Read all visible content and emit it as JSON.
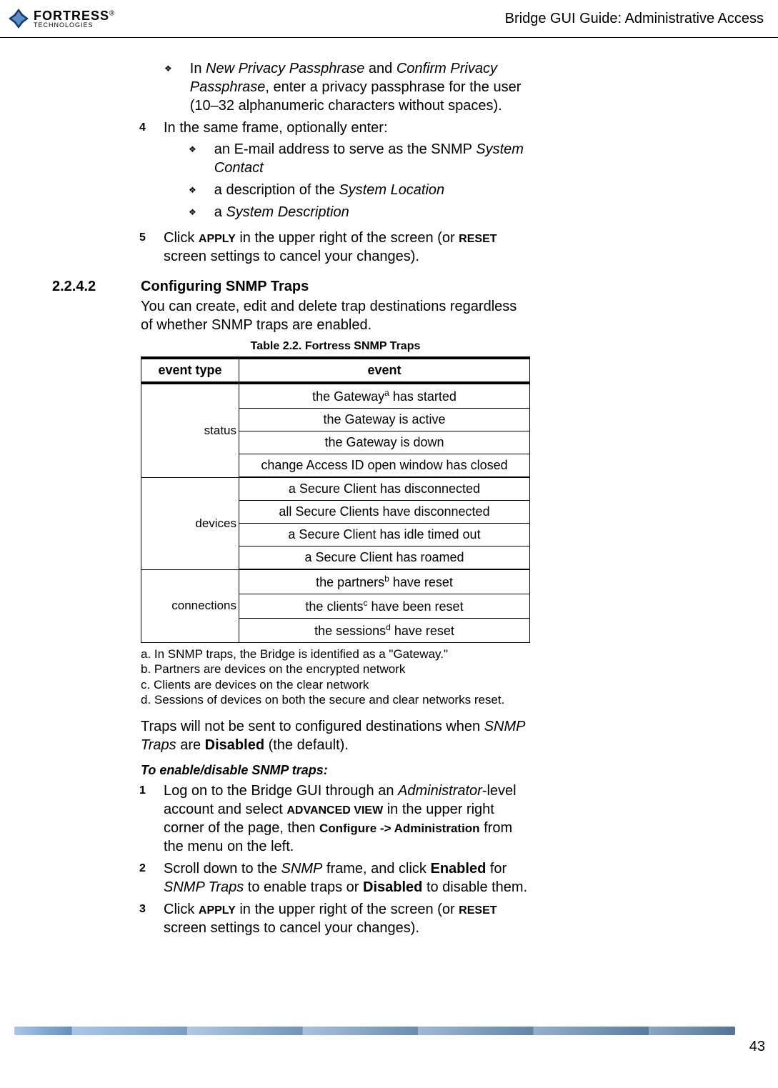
{
  "header": {
    "logo_text": "FORTRESS",
    "logo_sub": "TECHNOLOGIES",
    "title": "Bridge GUI Guide: Administrative Access"
  },
  "intro_bullet": {
    "text_prefix": "In ",
    "em1": "New Privacy Passphrase",
    "mid": " and ",
    "em2": "Confirm Privacy Passphrase",
    "text_suffix": ", enter a privacy passphrase for the user (10–32 alphanumeric characters without spaces)."
  },
  "step4": {
    "num": "4",
    "text": "In the same frame, optionally enter:",
    "bullets": [
      {
        "prefix": "an E-mail address to serve as the SNMP ",
        "em": "System Contact",
        "suffix": ""
      },
      {
        "prefix": "a description of the ",
        "em": "System Location",
        "suffix": ""
      },
      {
        "prefix": "a ",
        "em": "System Description",
        "suffix": ""
      }
    ]
  },
  "step5": {
    "num": "5",
    "pre": "Click ",
    "apply": "APPLY",
    "mid": " in the upper right of the screen (or ",
    "reset": "RESET",
    "post": " screen settings to cancel your changes)."
  },
  "section": {
    "num": "2.2.4.2",
    "title": "Configuring SNMP Traps",
    "intro": "You can create, edit and delete trap destinations regardless of whether SNMP traps are enabled."
  },
  "table": {
    "caption": "Table 2.2. Fortress SNMP Traps",
    "header_type": "event type",
    "header_event": "event",
    "groups": [
      {
        "type": "status",
        "events": [
          {
            "pre": "the Gateway",
            "sup": "a",
            "post": " has started"
          },
          {
            "pre": "the Gateway is active",
            "sup": "",
            "post": ""
          },
          {
            "pre": "the Gateway is down",
            "sup": "",
            "post": ""
          },
          {
            "pre": "change Access ID open window has closed",
            "sup": "",
            "post": ""
          }
        ]
      },
      {
        "type": "devices",
        "events": [
          {
            "pre": "a Secure Client has disconnected",
            "sup": "",
            "post": ""
          },
          {
            "pre": "all Secure Clients have disconnected",
            "sup": "",
            "post": ""
          },
          {
            "pre": "a Secure Client has idle timed out",
            "sup": "",
            "post": ""
          },
          {
            "pre": "a Secure Client has roamed",
            "sup": "",
            "post": ""
          }
        ]
      },
      {
        "type": "connections",
        "events": [
          {
            "pre": "the partners",
            "sup": "b",
            "post": " have reset"
          },
          {
            "pre": "the clients",
            "sup": "c",
            "post": " have been reset"
          },
          {
            "pre": "the sessions",
            "sup": "d",
            "post": " have reset"
          }
        ]
      }
    ]
  },
  "footnotes": {
    "a": "a. In SNMP traps, the Bridge is identified as a \"Gateway.\"",
    "b": "b. Partners are devices on the encrypted network",
    "c": "c. Clients are devices on the clear network",
    "d": "d. Sessions of devices on both the secure and clear networks reset."
  },
  "traps_note": {
    "pre": "Traps will not be sent to configured destinations when ",
    "em": "SNMP Traps",
    "mid": " are ",
    "bold": "Disabled",
    "post": " (the default)."
  },
  "subheading": "To enable/disable SNMP traps:",
  "steps2": {
    "s1": {
      "num": "1",
      "p1": "Log on to the Bridge GUI through an ",
      "em1": "Administrator",
      "p2": "-level account and select ",
      "b1": "ADVANCED VIEW",
      "p3": " in the upper right corner of the page, then ",
      "b2": "Configure -> Administration",
      "p4": " from the menu on the left."
    },
    "s2": {
      "num": "2",
      "p1": "Scroll down to the ",
      "em1": "SNMP",
      "p2": " frame, and click ",
      "b1": "Enabled",
      "p3": " for ",
      "em2": "SNMP Traps",
      "p4": " to enable traps or ",
      "b2": "Disabled",
      "p5": " to disable them."
    },
    "s3": {
      "num": "3",
      "p1": "Click ",
      "b1": "APPLY",
      "p2": " in the upper right of the screen (or ",
      "b2": "RESET",
      "p3": " screen settings to cancel your changes)."
    }
  },
  "page_num": "43"
}
